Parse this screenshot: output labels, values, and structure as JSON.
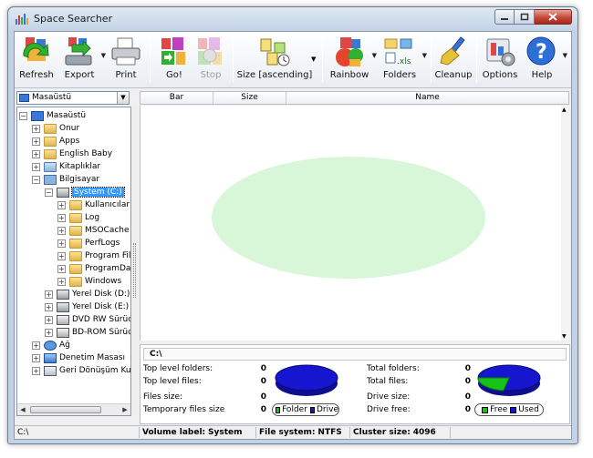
{
  "window": {
    "title": "Space Searcher"
  },
  "toolbar": {
    "refresh": "Refresh",
    "export": "Export",
    "print": "Print",
    "go": "Go!",
    "stop": "Stop",
    "size_sort": "Size [ascending]",
    "rainbow": "Rainbow",
    "folders": "Folders",
    "folders_badge": ".xls",
    "cleanup": "Cleanup",
    "options": "Options",
    "help": "Help",
    "help_glyph": "?"
  },
  "location": {
    "selected": "Masaüstü"
  },
  "tree": {
    "root": "Masaüstü",
    "items": [
      "Onur",
      "Apps",
      "English Baby",
      "Kitaplıklar",
      "Bilgisayar",
      "System (C:)",
      "Kullanıcılar",
      "Log",
      "MSOCache",
      "PerfLogs",
      "Program File",
      "ProgramDat",
      "Windows",
      "Yerel Disk (D:)",
      "Yerel Disk (E:)",
      "DVD RW Sürücü",
      "BD-ROM Sürücü",
      "Ağ",
      "Denetim Masası",
      "Geri Dönüşüm Kutus"
    ]
  },
  "columns": {
    "bar": "Bar",
    "size": "Size",
    "name": "Name"
  },
  "info": {
    "path": "C:\\",
    "top_level_folders_label": "Top level folders:",
    "top_level_folders": "0",
    "top_level_files_label": "Top level files:",
    "top_level_files": "0",
    "files_size_label": "Files size:",
    "files_size": "0",
    "temp_files_label": "Temporary files size",
    "temp_files": "0",
    "total_folders_label": "Total folders:",
    "total_folders": "0",
    "total_files_label": "Total files:",
    "total_files": "0",
    "drive_size_label": "Drive size:",
    "drive_size": "0",
    "drive_free_label": "Drive free:",
    "drive_free": "0",
    "legend1": {
      "folder": "Folder",
      "drive": "Drive"
    },
    "legend2": {
      "free": "Free",
      "used": "Used"
    }
  },
  "colors": {
    "folder": "#17c217",
    "drive": "#1616d0",
    "free": "#17c217",
    "used": "#1616d0",
    "selection": "#3399ff"
  },
  "status": {
    "path": "C:\\",
    "volume_label_label": "Volume label:",
    "volume_label": "System",
    "file_system_label": "File system:",
    "file_system": "NTFS",
    "cluster_size_label": "Cluster size:",
    "cluster_size": "4096"
  }
}
